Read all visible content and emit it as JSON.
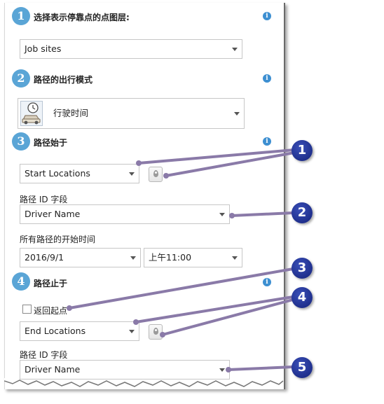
{
  "steps": [
    {
      "number": "1",
      "title": "选择表示停靠点的点图层:"
    },
    {
      "number": "2",
      "title": "路径的出行模式"
    },
    {
      "number": "3",
      "title": "路径始于"
    },
    {
      "number": "4",
      "title": "路径止于"
    }
  ],
  "info_icon_glyph": "i",
  "stop_layer": {
    "value": "Job sites"
  },
  "travel_mode": {
    "value": "行驶时间",
    "icon": "car-clock-icon"
  },
  "route_start": {
    "layer_value": "Start Locations",
    "route_id_label": "路径 ID 字段",
    "route_id_value": "Driver Name",
    "start_time_label": "所有路径的开始时间",
    "date_value": "2016/9/1",
    "time_value": "上午11:00"
  },
  "route_end": {
    "return_label": "返回起点",
    "return_checked": false,
    "layer_value": "End Locations",
    "route_id_label": "路径 ID 字段",
    "route_id_value": "Driver Name"
  },
  "callouts": [
    "1",
    "2",
    "3",
    "4",
    "5"
  ],
  "colors": {
    "step_badge": "#5aa5d6",
    "info_icon": "#3d8fd1",
    "callout": "#1b2a8a",
    "leader_line": "#8a7aa8"
  }
}
